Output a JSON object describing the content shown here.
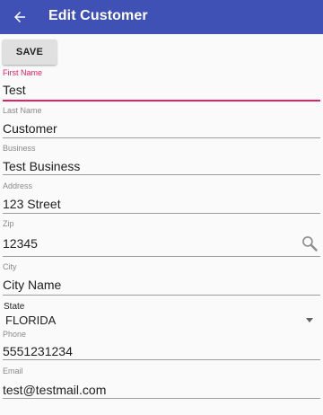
{
  "appbar": {
    "title": "Edit Customer",
    "back_icon": "arrow-back-icon",
    "color": "#3f51b5"
  },
  "toolbar": {
    "save_label": "SAVE"
  },
  "form": {
    "first_name": {
      "label": "First Name",
      "value": "Test"
    },
    "last_name": {
      "label": "Last Name",
      "value": "Customer"
    },
    "business": {
      "label": "Business",
      "value": "Test Business"
    },
    "address": {
      "label": "Address",
      "value": "123 Street"
    },
    "zip": {
      "label": "Zip",
      "value": "12345",
      "icon": "search-icon"
    },
    "city": {
      "label": "City",
      "value": "City Name"
    },
    "state": {
      "label": "State",
      "value": "FLORIDA",
      "icon": "dropdown-arrow-icon"
    },
    "phone": {
      "label": "Phone",
      "value": "5551231234"
    },
    "email": {
      "label": "Email",
      "value": "test@testmail.com"
    }
  },
  "colors": {
    "accent": "#e91e63",
    "underline": "#9e9e9e",
    "background": "#fafafa"
  }
}
